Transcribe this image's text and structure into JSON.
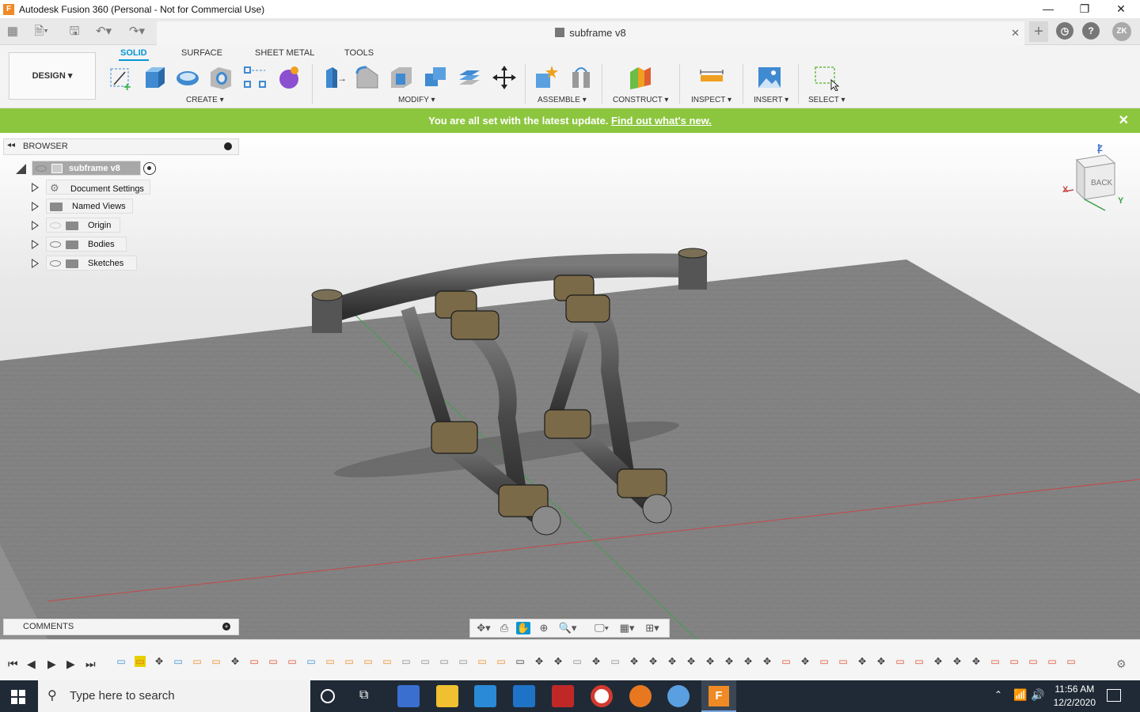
{
  "window": {
    "title": "Autodesk Fusion 360 (Personal - Not for Commercial Use)",
    "min": "—",
    "max": "❐",
    "close": "✕"
  },
  "tab": {
    "title": "subframe v8",
    "close": "✕"
  },
  "user": {
    "initials": "ZK"
  },
  "toolbar": {
    "workspace": "DESIGN ▾",
    "tabs": [
      "SOLID",
      "SURFACE",
      "SHEET METAL",
      "TOOLS"
    ],
    "groups": {
      "create": "CREATE ▾",
      "modify": "MODIFY ▾",
      "assemble": "ASSEMBLE ▾",
      "construct": "CONSTRUCT ▾",
      "inspect": "INSPECT ▾",
      "insert": "INSERT ▾",
      "select": "SELECT ▾"
    }
  },
  "banner": {
    "message": "You are all set with the latest update.",
    "link": "Find out what's new.",
    "close": "✕"
  },
  "browser": {
    "header": "BROWSER",
    "root": "subframe v8",
    "items": [
      "Document Settings",
      "Named Views",
      "Origin",
      "Bodies",
      "Sketches"
    ]
  },
  "viewcube": {
    "face": "BACK",
    "x": "X",
    "y": "Y",
    "z": "Z"
  },
  "comments": {
    "header": "COMMENTS"
  },
  "taskbar": {
    "search_placeholder": "Type here to search",
    "time": "11:56 AM",
    "date": "12/2/2020"
  }
}
